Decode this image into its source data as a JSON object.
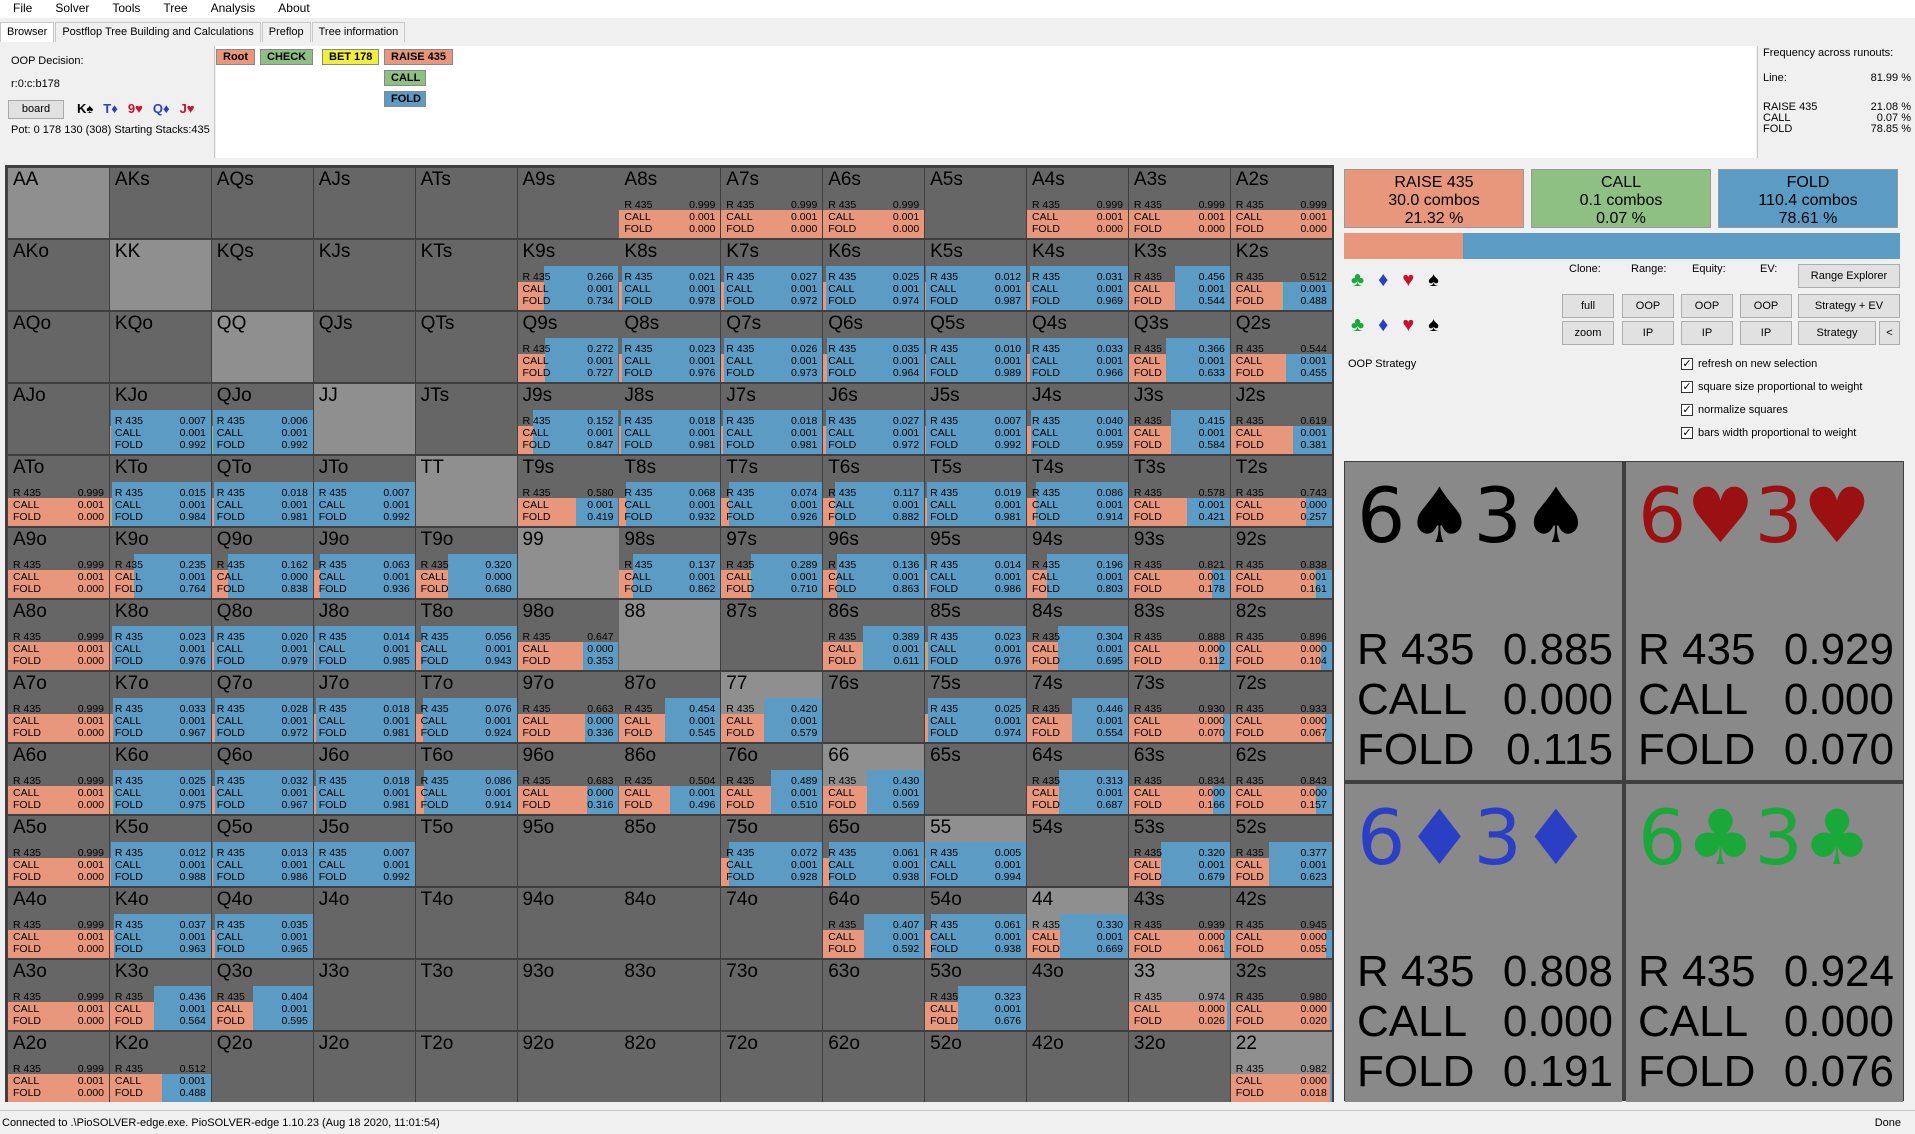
{
  "menu": [
    "File",
    "Solver",
    "Tools",
    "Tree",
    "Analysis",
    "About"
  ],
  "tabs": [
    "Browser",
    "Postflop Tree Building and Calculations",
    "Preflop",
    "Tree information"
  ],
  "info": {
    "decision": "OOP Decision:",
    "path": "r:0:c:b178",
    "board_btn": "board",
    "cards": [
      "K♠",
      "T♦",
      "9♥",
      "Q♦",
      "J♥"
    ],
    "pot": "Pot: 0 178 130 (308) Starting Stacks:435"
  },
  "tree": {
    "root": "Root",
    "check": "CHECK",
    "bet": "BET 178",
    "raise": "RAISE 435",
    "call": "CALL",
    "fold": "FOLD"
  },
  "freq": {
    "title": "Frequency across runouts:",
    "line_label": "Line:",
    "line_value": "81.99 %",
    "rows": [
      [
        "RAISE 435",
        "21.08 %"
      ],
      [
        "CALL",
        "0.07 %"
      ],
      [
        "FOLD",
        "78.85 %"
      ]
    ]
  },
  "colors": {
    "raise": "#e8967c",
    "call": "#8dc082",
    "fold": "#5b9bc4",
    "cell_default": "#666666",
    "cell_pair": "#8f8f8f"
  },
  "hands": [
    [
      "AA",
      "",
      "",
      "",
      1
    ],
    [
      "AKs",
      "",
      "",
      "",
      0
    ],
    [
      "AQs",
      "",
      "",
      "",
      0
    ],
    [
      "AJs",
      "",
      "",
      "",
      0
    ],
    [
      "ATs",
      "",
      "",
      "",
      0
    ],
    [
      "A9s",
      "",
      "",
      "",
      0
    ],
    [
      "A8s",
      "0.999",
      "0.001",
      "0.000",
      0
    ],
    [
      "A7s",
      "0.999",
      "0.001",
      "0.000",
      0
    ],
    [
      "A6s",
      "0.999",
      "0.001",
      "0.000",
      0
    ],
    [
      "A5s",
      "",
      "",
      "",
      0
    ],
    [
      "A4s",
      "0.999",
      "0.001",
      "0.000",
      0
    ],
    [
      "A3s",
      "0.999",
      "0.001",
      "0.000",
      0
    ],
    [
      "A2s",
      "0.999",
      "0.001",
      "0.000",
      0
    ],
    [
      "AKo",
      "",
      "",
      "",
      0
    ],
    [
      "KK",
      "",
      "",
      "",
      1
    ],
    [
      "KQs",
      "",
      "",
      "",
      0
    ],
    [
      "KJs",
      "",
      "",
      "",
      0
    ],
    [
      "KTs",
      "",
      "",
      "",
      0
    ],
    [
      "K9s",
      "0.266",
      "0.001",
      "0.734",
      0
    ],
    [
      "K8s",
      "0.021",
      "0.001",
      "0.978",
      0
    ],
    [
      "K7s",
      "0.027",
      "0.001",
      "0.972",
      0
    ],
    [
      "K6s",
      "0.025",
      "0.001",
      "0.974",
      0
    ],
    [
      "K5s",
      "0.012",
      "0.001",
      "0.987",
      0
    ],
    [
      "K4s",
      "0.031",
      "0.001",
      "0.969",
      0
    ],
    [
      "K3s",
      "0.456",
      "0.001",
      "0.544",
      0
    ],
    [
      "K2s",
      "0.512",
      "0.001",
      "0.488",
      0
    ],
    [
      "AQo",
      "",
      "",
      "",
      0
    ],
    [
      "KQo",
      "",
      "",
      "",
      0
    ],
    [
      "QQ",
      "",
      "",
      "",
      1
    ],
    [
      "QJs",
      "",
      "",
      "",
      0
    ],
    [
      "QTs",
      "",
      "",
      "",
      0
    ],
    [
      "Q9s",
      "0.272",
      "0.001",
      "0.727",
      0
    ],
    [
      "Q8s",
      "0.023",
      "0.001",
      "0.976",
      0
    ],
    [
      "Q7s",
      "0.026",
      "0.001",
      "0.973",
      0
    ],
    [
      "Q6s",
      "0.035",
      "0.001",
      "0.964",
      0
    ],
    [
      "Q5s",
      "0.010",
      "0.001",
      "0.989",
      0
    ],
    [
      "Q4s",
      "0.033",
      "0.001",
      "0.966",
      0
    ],
    [
      "Q3s",
      "0.366",
      "0.001",
      "0.633",
      0
    ],
    [
      "Q2s",
      "0.544",
      "0.001",
      "0.455",
      0
    ],
    [
      "AJo",
      "",
      "",
      "",
      0
    ],
    [
      "KJo",
      "0.007",
      "0.001",
      "0.992",
      0
    ],
    [
      "QJo",
      "0.006",
      "0.001",
      "0.992",
      0
    ],
    [
      "JJ",
      "",
      "",
      "",
      1
    ],
    [
      "JTs",
      "",
      "",
      "",
      0
    ],
    [
      "J9s",
      "0.152",
      "0.001",
      "0.847",
      0
    ],
    [
      "J8s",
      "0.018",
      "0.001",
      "0.981",
      0
    ],
    [
      "J7s",
      "0.018",
      "0.001",
      "0.981",
      0
    ],
    [
      "J6s",
      "0.027",
      "0.001",
      "0.972",
      0
    ],
    [
      "J5s",
      "0.007",
      "0.001",
      "0.992",
      0
    ],
    [
      "J4s",
      "0.040",
      "0.001",
      "0.959",
      0
    ],
    [
      "J3s",
      "0.415",
      "0.001",
      "0.584",
      0
    ],
    [
      "J2s",
      "0.619",
      "0.001",
      "0.381",
      0
    ],
    [
      "ATo",
      "0.999",
      "0.001",
      "0.000",
      0
    ],
    [
      "KTo",
      "0.015",
      "0.001",
      "0.984",
      0
    ],
    [
      "QTo",
      "0.018",
      "0.001",
      "0.981",
      0
    ],
    [
      "JTo",
      "0.007",
      "0.001",
      "0.992",
      0
    ],
    [
      "TT",
      "",
      "",
      "",
      1
    ],
    [
      "T9s",
      "0.580",
      "0.001",
      "0.419",
      0
    ],
    [
      "T8s",
      "0.068",
      "0.001",
      "0.932",
      0
    ],
    [
      "T7s",
      "0.074",
      "0.001",
      "0.926",
      0
    ],
    [
      "T6s",
      "0.117",
      "0.001",
      "0.882",
      0
    ],
    [
      "T5s",
      "0.019",
      "0.001",
      "0.981",
      0
    ],
    [
      "T4s",
      "0.086",
      "0.001",
      "0.914",
      0
    ],
    [
      "T3s",
      "0.578",
      "0.001",
      "0.421",
      0
    ],
    [
      "T2s",
      "0.743",
      "0.000",
      "0.257",
      0
    ],
    [
      "A9o",
      "0.999",
      "0.001",
      "0.000",
      0
    ],
    [
      "K9o",
      "0.235",
      "0.001",
      "0.764",
      0
    ],
    [
      "Q9o",
      "0.162",
      "0.000",
      "0.838",
      0
    ],
    [
      "J9o",
      "0.063",
      "0.001",
      "0.936",
      0
    ],
    [
      "T9o",
      "0.320",
      "0.000",
      "0.680",
      0
    ],
    [
      "99",
      "",
      "",
      "",
      1
    ],
    [
      "98s",
      "0.137",
      "0.001",
      "0.862",
      0
    ],
    [
      "97s",
      "0.289",
      "0.001",
      "0.710",
      0
    ],
    [
      "96s",
      "0.136",
      "0.001",
      "0.863",
      0
    ],
    [
      "95s",
      "0.014",
      "0.001",
      "0.986",
      0
    ],
    [
      "94s",
      "0.196",
      "0.001",
      "0.803",
      0
    ],
    [
      "93s",
      "0.821",
      "0.001",
      "0.178",
      0
    ],
    [
      "92s",
      "0.838",
      "0.001",
      "0.161",
      0
    ],
    [
      "A8o",
      "0.999",
      "0.001",
      "0.000",
      0
    ],
    [
      "K8o",
      "0.023",
      "0.001",
      "0.976",
      0
    ],
    [
      "Q8o",
      "0.020",
      "0.001",
      "0.979",
      0
    ],
    [
      "J8o",
      "0.014",
      "0.001",
      "0.985",
      0
    ],
    [
      "T8o",
      "0.056",
      "0.001",
      "0.943",
      0
    ],
    [
      "98o",
      "0.647",
      "0.000",
      "0.353",
      0
    ],
    [
      "88",
      "",
      "",
      "",
      1
    ],
    [
      "87s",
      "",
      "",
      "",
      0
    ],
    [
      "86s",
      "0.389",
      "0.001",
      "0.611",
      0
    ],
    [
      "85s",
      "0.023",
      "0.001",
      "0.976",
      0
    ],
    [
      "84s",
      "0.304",
      "0.001",
      "0.695",
      0
    ],
    [
      "83s",
      "0.888",
      "0.000",
      "0.112",
      0
    ],
    [
      "82s",
      "0.896",
      "0.000",
      "0.104",
      0
    ],
    [
      "A7o",
      "0.999",
      "0.001",
      "0.000",
      0
    ],
    [
      "K7o",
      "0.033",
      "0.001",
      "0.967",
      0
    ],
    [
      "Q7o",
      "0.028",
      "0.001",
      "0.972",
      0
    ],
    [
      "J7o",
      "0.018",
      "0.001",
      "0.981",
      0
    ],
    [
      "T7o",
      "0.076",
      "0.001",
      "0.924",
      0
    ],
    [
      "97o",
      "0.663",
      "0.000",
      "0.336",
      0
    ],
    [
      "87o",
      "0.454",
      "0.001",
      "0.545",
      0
    ],
    [
      "77",
      "0.420",
      "0.001",
      "0.579",
      1
    ],
    [
      "76s",
      "",
      "",
      "",
      0
    ],
    [
      "75s",
      "0.025",
      "0.001",
      "0.974",
      0
    ],
    [
      "74s",
      "0.446",
      "0.001",
      "0.554",
      0
    ],
    [
      "73s",
      "0.930",
      "0.000",
      "0.070",
      0
    ],
    [
      "72s",
      "0.933",
      "0.000",
      "0.067",
      0
    ],
    [
      "A6o",
      "0.999",
      "0.001",
      "0.000",
      0
    ],
    [
      "K6o",
      "0.025",
      "0.001",
      "0.975",
      0
    ],
    [
      "Q6o",
      "0.032",
      "0.001",
      "0.967",
      0
    ],
    [
      "J6o",
      "0.018",
      "0.001",
      "0.981",
      0
    ],
    [
      "T6o",
      "0.086",
      "0.001",
      "0.914",
      0
    ],
    [
      "96o",
      "0.683",
      "0.000",
      "0.316",
      0
    ],
    [
      "86o",
      "0.504",
      "0.001",
      "0.496",
      0
    ],
    [
      "76o",
      "0.489",
      "0.001",
      "0.510",
      0
    ],
    [
      "66",
      "0.430",
      "0.001",
      "0.569",
      1
    ],
    [
      "65s",
      "",
      "",
      "",
      0
    ],
    [
      "64s",
      "0.313",
      "0.001",
      "0.687",
      0
    ],
    [
      "63s",
      "0.834",
      "0.000",
      "0.166",
      0
    ],
    [
      "62s",
      "0.843",
      "0.000",
      "0.157",
      0
    ],
    [
      "A5o",
      "0.999",
      "0.001",
      "0.000",
      0
    ],
    [
      "K5o",
      "0.012",
      "0.001",
      "0.988",
      0
    ],
    [
      "Q5o",
      "0.013",
      "0.001",
      "0.986",
      0
    ],
    [
      "J5o",
      "0.007",
      "0.001",
      "0.992",
      0
    ],
    [
      "T5o",
      "",
      "",
      "",
      0
    ],
    [
      "95o",
      "",
      "",
      "",
      0
    ],
    [
      "85o",
      "",
      "",
      "",
      0
    ],
    [
      "75o",
      "0.072",
      "0.001",
      "0.928",
      0
    ],
    [
      "65o",
      "0.061",
      "0.001",
      "0.938",
      0
    ],
    [
      "55",
      "0.005",
      "0.001",
      "0.994",
      1
    ],
    [
      "54s",
      "",
      "",
      "",
      0
    ],
    [
      "53s",
      "0.320",
      "0.001",
      "0.679",
      0
    ],
    [
      "52s",
      "0.377",
      "0.001",
      "0.623",
      0
    ],
    [
      "A4o",
      "0.999",
      "0.001",
      "0.000",
      0
    ],
    [
      "K4o",
      "0.037",
      "0.001",
      "0.963",
      0
    ],
    [
      "Q4o",
      "0.035",
      "0.001",
      "0.965",
      0
    ],
    [
      "J4o",
      "",
      "",
      "",
      0
    ],
    [
      "T4o",
      "",
      "",
      "",
      0
    ],
    [
      "94o",
      "",
      "",
      "",
      0
    ],
    [
      "84o",
      "",
      "",
      "",
      0
    ],
    [
      "74o",
      "",
      "",
      "",
      0
    ],
    [
      "64o",
      "0.407",
      "0.001",
      "0.592",
      0
    ],
    [
      "54o",
      "0.061",
      "0.001",
      "0.938",
      0
    ],
    [
      "44",
      "0.330",
      "0.001",
      "0.669",
      1
    ],
    [
      "43s",
      "0.939",
      "0.000",
      "0.061",
      0
    ],
    [
      "42s",
      "0.945",
      "0.000",
      "0.055",
      0
    ],
    [
      "A3o",
      "0.999",
      "0.001",
      "0.000",
      0
    ],
    [
      "K3o",
      "0.436",
      "0.001",
      "0.564",
      0
    ],
    [
      "Q3o",
      "0.404",
      "0.001",
      "0.595",
      0
    ],
    [
      "J3o",
      "",
      "",
      "",
      0
    ],
    [
      "T3o",
      "",
      "",
      "",
      0
    ],
    [
      "93o",
      "",
      "",
      "",
      0
    ],
    [
      "83o",
      "",
      "",
      "",
      0
    ],
    [
      "73o",
      "",
      "",
      "",
      0
    ],
    [
      "63o",
      "",
      "",
      "",
      0
    ],
    [
      "53o",
      "0.323",
      "0.001",
      "0.676",
      0
    ],
    [
      "43o",
      "",
      "",
      "",
      0
    ],
    [
      "33",
      "0.974",
      "0.000",
      "0.026",
      1
    ],
    [
      "32s",
      "0.980",
      "0.000",
      "0.020",
      0
    ],
    [
      "A2o",
      "0.999",
      "0.001",
      "0.000",
      0
    ],
    [
      "K2o",
      "0.512",
      "0.001",
      "0.488",
      0
    ],
    [
      "Q2o",
      "",
      "",
      "",
      0
    ],
    [
      "J2o",
      "",
      "",
      "",
      0
    ],
    [
      "T2o",
      "",
      "",
      "",
      0
    ],
    [
      "92o",
      "",
      "",
      "",
      0
    ],
    [
      "82o",
      "",
      "",
      "",
      0
    ],
    [
      "72o",
      "",
      "",
      "",
      0
    ],
    [
      "62o",
      "",
      "",
      "",
      0
    ],
    [
      "52o",
      "",
      "",
      "",
      0
    ],
    [
      "42o",
      "",
      "",
      "",
      0
    ],
    [
      "32o",
      "",
      "",
      "",
      0
    ],
    [
      "22",
      "0.982",
      "0.000",
      "0.018",
      1
    ]
  ],
  "summary": [
    {
      "label": "RAISE 435",
      "combos": "30.0 combos",
      "pct": "21.32 %",
      "frac": 0.2132
    },
    {
      "label": "CALL",
      "combos": "0.1 combos",
      "pct": "0.07 %",
      "frac": 0.0007
    },
    {
      "label": "FOLD",
      "combos": "110.4 combos",
      "pct": "78.61 %",
      "frac": 0.7861
    }
  ],
  "suits": [
    "♣",
    "♦",
    "♥",
    "♠"
  ],
  "controls": {
    "clone": "Clone:",
    "range": "Range:",
    "equity": "Equity:",
    "ev": "EV:",
    "range_explorer": "Range Explorer",
    "full": "full",
    "zoom": "zoom",
    "oop": "OOP",
    "ip": "IP",
    "strategy_ev": "Strategy + EV",
    "strategy": "Strategy",
    "back": "<",
    "strategy_label": "OOP Strategy"
  },
  "checks": [
    "refresh on new selection",
    "square size proportional to weight",
    "normalize squares",
    "bars width proportional to weight"
  ],
  "combo_detail": [
    {
      "hand": "6♠3♠",
      "color": "#000000",
      "raise": "0.885",
      "call": "0.000",
      "fold": "0.115"
    },
    {
      "hand": "6♥3♥",
      "color": "#9b1010",
      "raise": "0.929",
      "call": "0.000",
      "fold": "0.070"
    },
    {
      "hand": "6♦3♦",
      "color": "#2a3fc4",
      "raise": "0.808",
      "call": "0.000",
      "fold": "0.191"
    },
    {
      "hand": "6♣3♣",
      "color": "#1aa83a",
      "raise": "0.924",
      "call": "0.000",
      "fold": "0.076"
    }
  ],
  "labels": {
    "r": "R 435",
    "call": "CALL",
    "fold": "FOLD"
  },
  "status": {
    "left": "Connected to .\\PioSOLVER-edge.exe. PioSOLVER-edge 1.10.23 (Aug 18 2020, 11:01:54)",
    "right": "Done"
  }
}
